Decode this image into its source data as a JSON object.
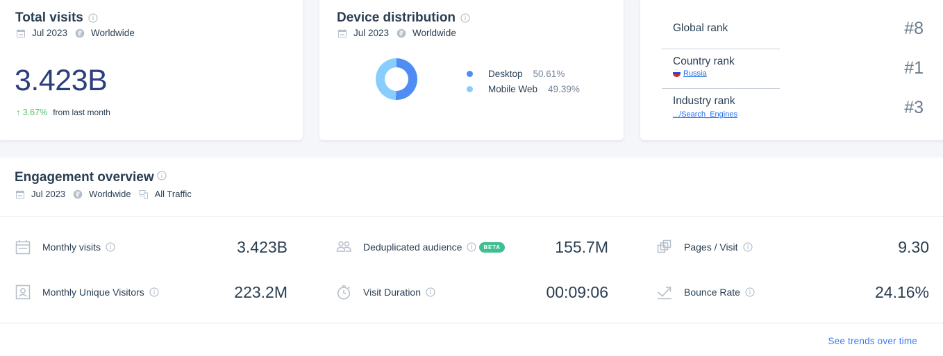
{
  "total_visits": {
    "title": "Total visits",
    "date": "Jul 2023",
    "region": "Worldwide",
    "value": "3.423B",
    "change": "3.67%",
    "change_direction": "up",
    "change_label": "from last month",
    "colors": {
      "value": "#2b3f7e",
      "change_up": "#4fc26b"
    }
  },
  "device_distribution": {
    "title": "Device distribution",
    "date": "Jul 2023",
    "region": "Worldwide",
    "legend": [
      {
        "label": "Desktop",
        "value": "50.61%",
        "color": "#4f8df5"
      },
      {
        "label": "Mobile Web",
        "value": "49.39%",
        "color": "#88cdfb"
      }
    ]
  },
  "chart_data": {
    "type": "pie",
    "title": "Device distribution",
    "categories": [
      "Desktop",
      "Mobile Web"
    ],
    "values": [
      50.61,
      49.39
    ],
    "colors": [
      "#4f8df5",
      "#88cdfb"
    ],
    "donut": true,
    "legend_position": "right"
  },
  "ranks": {
    "items": [
      {
        "label": "Global rank",
        "value": "#8",
        "link": null
      },
      {
        "label": "Country rank",
        "value": "#1",
        "link": "Russia",
        "flag": "russia-flag"
      },
      {
        "label": "Industry rank",
        "value": "#3",
        "link": ".../Search_Engines"
      }
    ]
  },
  "engagement": {
    "title": "Engagement overview",
    "date": "Jul 2023",
    "region": "Worldwide",
    "traffic": "All Traffic",
    "metrics": [
      {
        "icon": "calendar-icon",
        "label": "Monthly visits",
        "value": "3.423B"
      },
      {
        "icon": "unique-visitor-icon",
        "label": "Monthly Unique Visitors",
        "value": "223.2M"
      },
      {
        "icon": "users-icon",
        "label": "Deduplicated audience",
        "value": "155.7M",
        "badge": "BETA"
      },
      {
        "icon": "stopwatch-icon",
        "label": "Visit Duration",
        "value": "00:09:06"
      },
      {
        "icon": "pages-icon",
        "label": "Pages / Visit",
        "value": "9.30"
      },
      {
        "icon": "bounce-icon",
        "label": "Bounce Rate",
        "value": "24.16%"
      }
    ],
    "see_trends_label": "See trends over time",
    "colors": {
      "badge": "#3fbf92",
      "link": "#3b7cf0"
    }
  }
}
